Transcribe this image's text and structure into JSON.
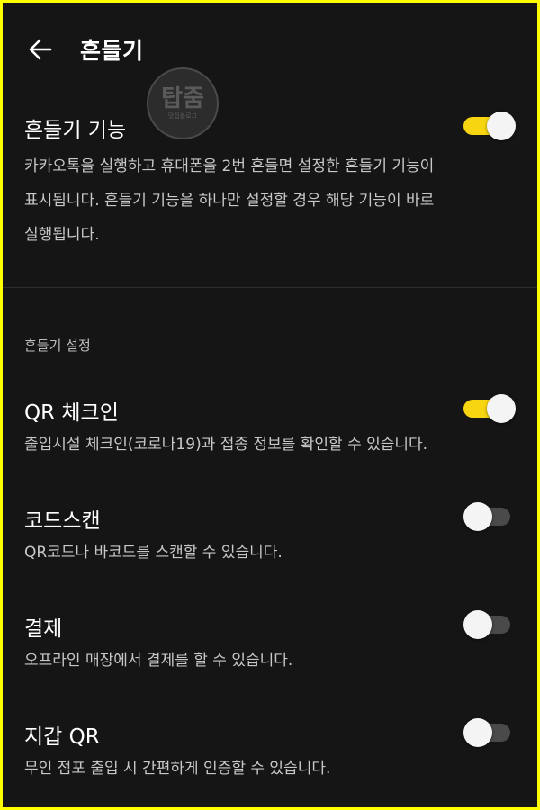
{
  "header": {
    "title": "흔들기",
    "back_icon": "arrow-left-icon"
  },
  "watermark": {
    "main": "탑줌",
    "sub": "맛집블로그"
  },
  "main_setting": {
    "title": "흔들기 기능",
    "desc_lines": [
      "카카오톡을 실행하고 휴대폰을 2번 흔들면 설정한 흔들기 기능이",
      "표시됩니다. 흔들기 기능을 하나만 설정할 경우 해당 기능이 바로",
      "실행됩니다."
    ],
    "enabled": true
  },
  "section_header": "흔들기 설정",
  "items": [
    {
      "title": "QR 체크인",
      "desc": "출입시설 체크인(코로나19)과 접종 정보를 확인할 수 있습니다.",
      "enabled": true
    },
    {
      "title": "코드스캔",
      "desc": "QR코드나 바코드를 스캔할 수 있습니다.",
      "enabled": false
    },
    {
      "title": "결제",
      "desc": "오프라인 매장에서 결제를 할 수 있습니다.",
      "enabled": false
    },
    {
      "title": "지갑 QR",
      "desc": "무인 점포 출입 시 간편하게 인증할 수 있습니다.",
      "enabled": false
    }
  ],
  "colors": {
    "background": "#151515",
    "accent": "#f7d511",
    "frame": "#ffff00"
  }
}
